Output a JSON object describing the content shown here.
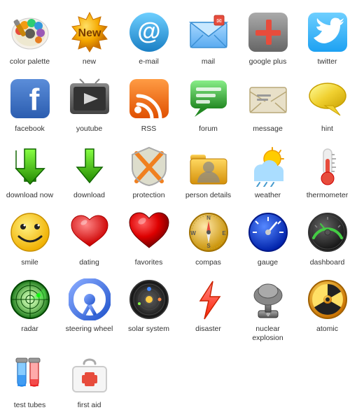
{
  "icons": [
    {
      "id": "color-palette",
      "label": "color palette",
      "row": 1
    },
    {
      "id": "new",
      "label": "new",
      "row": 1
    },
    {
      "id": "email",
      "label": "e-mail",
      "row": 1
    },
    {
      "id": "mail",
      "label": "mail",
      "row": 1
    },
    {
      "id": "google-plus",
      "label": "google plus",
      "row": 1
    },
    {
      "id": "twitter",
      "label": "twitter",
      "row": 1
    },
    {
      "id": "facebook",
      "label": "facebook",
      "row": 2
    },
    {
      "id": "youtube",
      "label": "youtube",
      "row": 2
    },
    {
      "id": "rss",
      "label": "RSS",
      "row": 2
    },
    {
      "id": "forum",
      "label": "forum",
      "row": 2
    },
    {
      "id": "message",
      "label": "message",
      "row": 2
    },
    {
      "id": "hint",
      "label": "hint",
      "row": 2
    },
    {
      "id": "download-now",
      "label": "download now",
      "row": 3
    },
    {
      "id": "download",
      "label": "download",
      "row": 3
    },
    {
      "id": "protection",
      "label": "protection",
      "row": 3
    },
    {
      "id": "person-details",
      "label": "person details",
      "row": 3
    },
    {
      "id": "weather",
      "label": "weather",
      "row": 3
    },
    {
      "id": "thermometer",
      "label": "thermometer",
      "row": 3
    },
    {
      "id": "smile",
      "label": "smile",
      "row": 4
    },
    {
      "id": "dating",
      "label": "dating",
      "row": 4
    },
    {
      "id": "favorites",
      "label": "favorites",
      "row": 4
    },
    {
      "id": "compas",
      "label": "compas",
      "row": 4
    },
    {
      "id": "gauge",
      "label": "gauge",
      "row": 4
    },
    {
      "id": "dashboard",
      "label": "dashboard",
      "row": 4
    },
    {
      "id": "radar",
      "label": "radar",
      "row": 5
    },
    {
      "id": "steering-wheel",
      "label": "steering wheel",
      "row": 5
    },
    {
      "id": "solar-system",
      "label": "solar system",
      "row": 5
    },
    {
      "id": "disaster",
      "label": "disaster",
      "row": 5
    },
    {
      "id": "nuclear-explosion",
      "label": "nuclear\nexplosion",
      "row": 5
    },
    {
      "id": "atomic",
      "label": "atomic",
      "row": 5
    },
    {
      "id": "test-tubes",
      "label": "test tubes",
      "row": 6
    },
    {
      "id": "first-aid",
      "label": "first aid",
      "row": 6
    }
  ]
}
